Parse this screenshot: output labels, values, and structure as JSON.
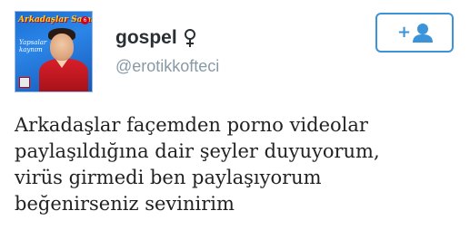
{
  "profile": {
    "display_name": "gospel",
    "handle": "@erotikkofteci",
    "gender_icon": "female-symbol-icon",
    "avatar": {
      "cover_title": "Arkadaşlar Samik",
      "cover_number": "6",
      "cover_subtitle": "Yapsalar kaynım"
    }
  },
  "follow_button": {
    "icon": "add-user-icon",
    "plus_glyph": "+"
  },
  "tweet": {
    "lines": [
      "Arkadaşlar façemden porno videolar",
      "paylaşıldığına dair şeyler duyuyorum,",
      "virüs girmedi ben paylaşıyorum",
      "beğenirseniz sevinirim"
    ]
  },
  "colors": {
    "accent": "#3b94d9",
    "name": "#292f33",
    "handle": "#8899a6",
    "text": "#222222"
  }
}
